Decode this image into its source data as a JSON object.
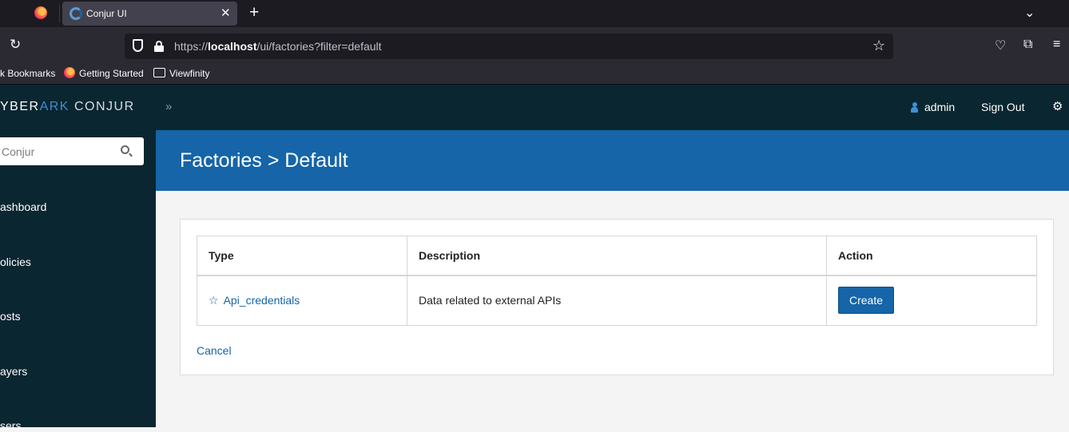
{
  "browser": {
    "tab_title": "Conjur UI",
    "url_scheme": "https://",
    "url_host": "localhost",
    "url_path": "/ui/factories?filter=default",
    "bookmarks": [
      "k Bookmarks",
      "Getting Started",
      "Viewfinity"
    ]
  },
  "header": {
    "brand_left": "YBER",
    "brand_ark": "ARK",
    "brand_product": "CONJUR",
    "username": "admin",
    "sign_out": "Sign Out"
  },
  "sidebar": {
    "search_placeholder": "Conjur",
    "items": [
      "ashboard",
      "olicies",
      "osts",
      "ayers",
      "sers"
    ]
  },
  "page": {
    "title": "Factories > Default",
    "table": {
      "headers": [
        "Type",
        "Description",
        "Action"
      ],
      "rows": [
        {
          "type": "Api_credentials",
          "description": "Data related to external APIs",
          "action": "Create"
        }
      ]
    },
    "cancel_label": "Cancel"
  }
}
